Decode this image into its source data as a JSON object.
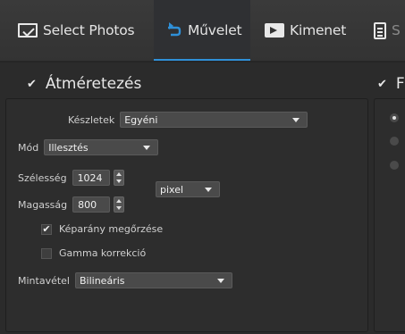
{
  "tabs": [
    {
      "label": "Select Photos",
      "icon": "photo-select-icon"
    },
    {
      "label": "Művelet",
      "icon": "operation-icon",
      "active": true
    },
    {
      "label": "Kimenet",
      "icon": "output-icon"
    },
    {
      "label": "S",
      "icon": "clipboard-icon"
    }
  ],
  "accent_color": "#2f90d8",
  "resize": {
    "title": "Átméretezés",
    "enabled": true,
    "preset_label": "Készletek",
    "preset_value": "Egyéni",
    "mode_label": "Mód",
    "mode_value": "Illesztés",
    "width_label": "Szélesség",
    "width_value": "1024",
    "height_label": "Magasság",
    "height_value": "800",
    "unit_value": "pixel",
    "keep_ratio_label": "Képarány megőrzése",
    "keep_ratio_checked": true,
    "gamma_label": "Gamma korrekció",
    "gamma_checked": false,
    "sampling_label": "Mintavétel",
    "sampling_value": "Bilineáris"
  },
  "right_section": {
    "title": "F",
    "enabled": true
  }
}
